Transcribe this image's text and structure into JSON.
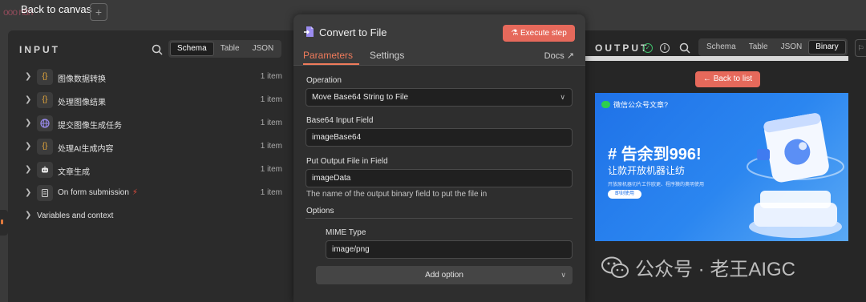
{
  "topbar": {
    "back_label": "Back to canvas",
    "ghost_text": "ooo n8n",
    "plus": "+"
  },
  "input_panel": {
    "title": "INPUT",
    "views": [
      "Schema",
      "Table",
      "JSON"
    ],
    "active_view": "Schema",
    "nodes": [
      {
        "label": "图像数据转换",
        "count": "1 item",
        "icon": "{}"
      },
      {
        "label": "处理图像结果",
        "count": "1 item",
        "icon": "{}"
      },
      {
        "label": "提交图像生成任务",
        "count": "1 item",
        "icon": "globe-icon"
      },
      {
        "label": "处理AI生成内容",
        "count": "1 item",
        "icon": "{}"
      },
      {
        "label": "文章生成",
        "count": "1 item",
        "icon": "robot-icon"
      },
      {
        "label": "On form submission",
        "count": "1 item",
        "icon": "form-icon"
      }
    ],
    "variables_label": "Variables and context"
  },
  "center_panel": {
    "title": "Convert to File",
    "execute_label": "Execute step",
    "tabs": [
      "Parameters",
      "Settings"
    ],
    "docs_label": "Docs",
    "operation": {
      "label": "Operation",
      "value": "Move Base64 String to File"
    },
    "base64_field": {
      "label": "Base64 Input Field",
      "value": "imageBase64"
    },
    "output_field": {
      "label": "Put Output File in Field",
      "value": "imageData",
      "hint": "The name of the output binary field to put the file in"
    },
    "options_label": "Options",
    "mime": {
      "label": "MIME Type",
      "value": "image/png"
    },
    "add_option_label": "Add option"
  },
  "output_panel": {
    "title": "OUTPUT",
    "views": [
      "Schema",
      "Table",
      "JSON",
      "Binary"
    ],
    "active_view": "Binary",
    "back_to_list": "Back to list",
    "banner": {
      "head": "微信公众号文章?",
      "title": "# 告余到996!",
      "subtitle": "让款开放机器让纺",
      "desc": "开放原机器切片工作欧更、程序猿的奥明使用",
      "button": "即刻使用"
    },
    "watermark": "公众号 · 老王AIGC"
  },
  "colors": {
    "accent": "#e6695b",
    "tab_active": "#f07b5b",
    "success": "#3fbf6b",
    "banner_blue": "#1f72e8"
  }
}
